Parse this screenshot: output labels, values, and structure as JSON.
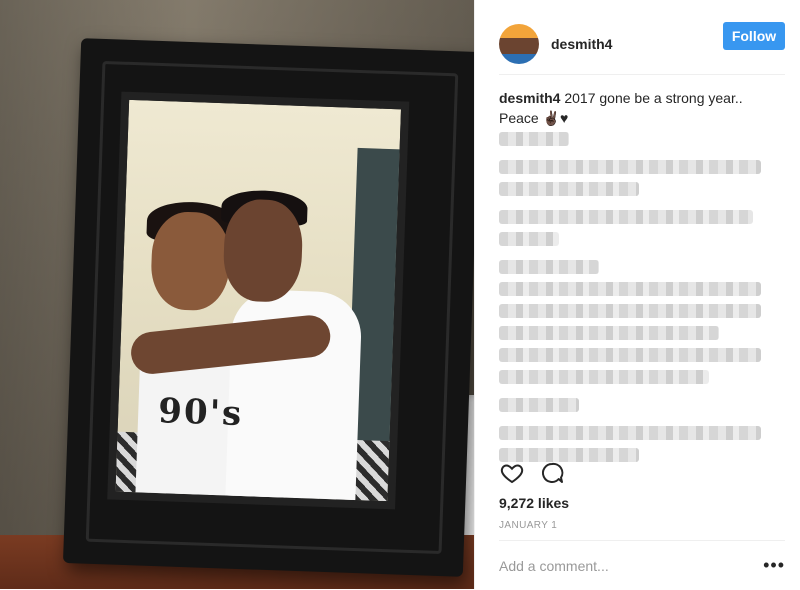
{
  "post": {
    "username": "desmith4",
    "follow_label": "Follow",
    "caption_user": "desmith4",
    "caption_text": "2017 gone be a strong year.. Peace",
    "caption_emoji": "✌🏿♥",
    "likes": "9,272 likes",
    "date": "JANUARY 1",
    "comment_placeholder": "Add a comment...",
    "more_label": "•••"
  },
  "photo": {
    "shirt_print": "90's"
  },
  "colors": {
    "follow_button": "#3897f0",
    "text": "#262626",
    "muted": "#999999"
  },
  "icons": [
    "heart-icon",
    "comment-icon",
    "more-options-icon"
  ]
}
